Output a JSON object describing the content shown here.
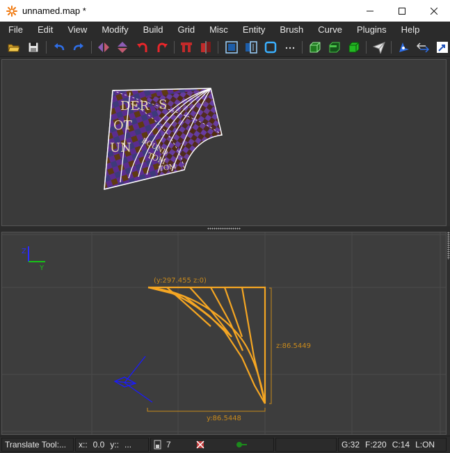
{
  "window": {
    "title": "unnamed.map *"
  },
  "menu": [
    "File",
    "Edit",
    "View",
    "Modify",
    "Build",
    "Grid",
    "Misc",
    "Entity",
    "Brush",
    "Curve",
    "Plugins",
    "Help"
  ],
  "toolbar": {
    "icons": [
      "open-icon",
      "save-icon",
      "undo-icon",
      "redo-icon",
      "flip-x-icon",
      "flip-y-icon",
      "rotate-left-icon",
      "rotate-right-icon",
      "csg-subtract-icon",
      "csg-merge-icon",
      "select-inside-icon",
      "select-touching-icon",
      "hollow-icon",
      "more-icon",
      "texture-lock-icon",
      "brush-clip-icon",
      "cube-icon",
      "clipper-icon",
      "camera-icon",
      "move-icon",
      "transform-icon"
    ]
  },
  "viewport3d": {
    "texture_text": [
      "DER",
      "S",
      "OT",
      "UN",
      "TOM",
      "BOUND",
      "TOM"
    ]
  },
  "viewport2d": {
    "axis_vertical": "Z",
    "axis_horizontal": "Y",
    "label_top": "(y:297.455  z:0)",
    "label_right": "z:86.5449",
    "label_bottom": "y:86.5448"
  },
  "status": {
    "tool": "Translate Tool:...",
    "x_label": "x::",
    "x_value": "0.0",
    "y_label": "y::",
    "y_value": "...",
    "brush_count": "7",
    "grid": "G:32",
    "fov": "F:220",
    "clip": "C:14",
    "lock": "L:ON"
  },
  "colors": {
    "selection": "#f5a623",
    "axis_z": "#2b2bff",
    "axis_y": "#16c316",
    "camera": "#1a1aff"
  }
}
